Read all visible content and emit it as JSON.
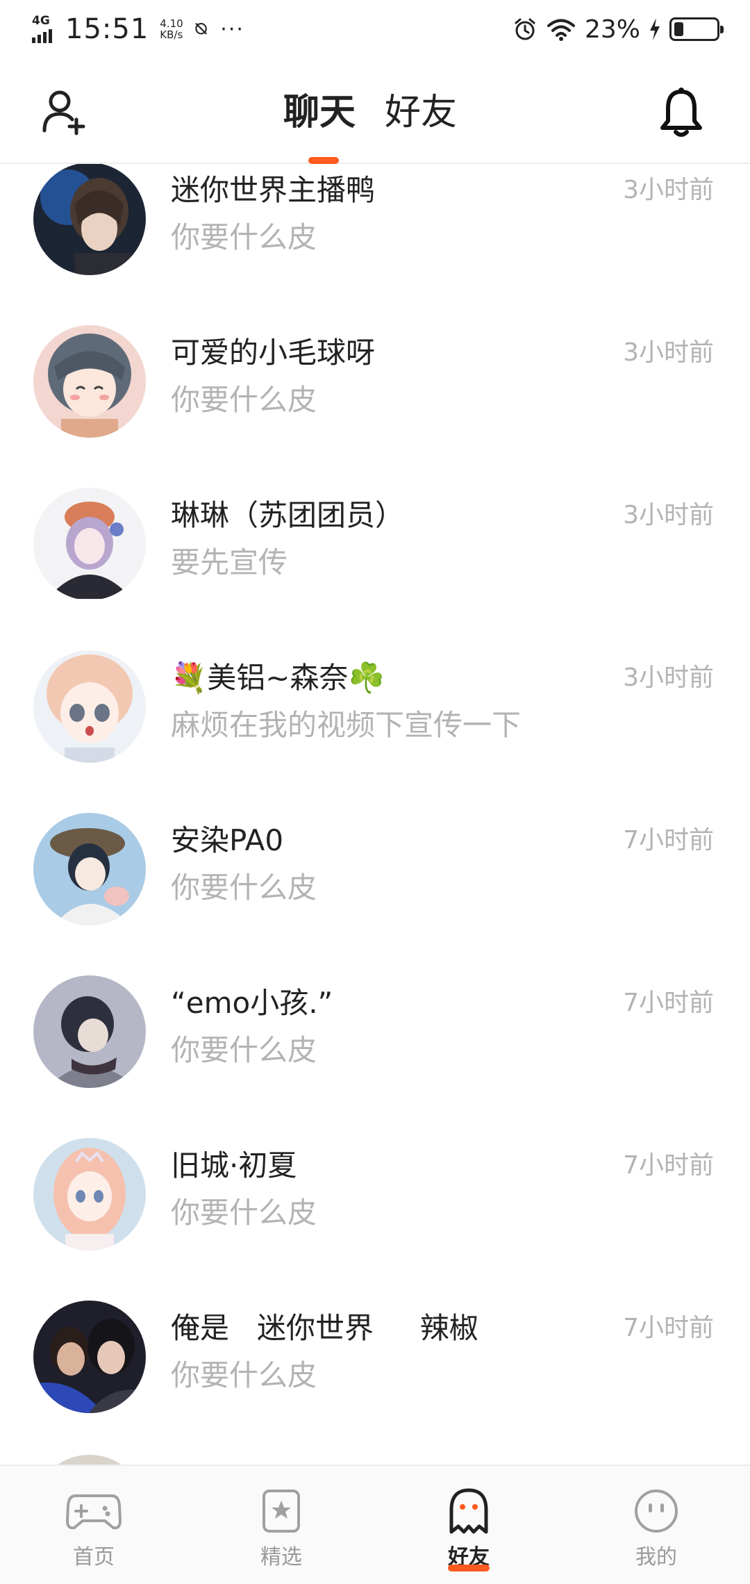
{
  "status_bar": {
    "network": "4G",
    "time": "15:51",
    "speed_value": "4.10",
    "speed_unit": "KB/s",
    "more": "···",
    "battery_pct": "23%",
    "battery_level": 0.23
  },
  "header": {
    "tabs": [
      {
        "label": "聊天",
        "active": true
      },
      {
        "label": "好友",
        "active": false
      }
    ],
    "left_icon": "add-friend-icon",
    "right_icon": "bell-icon"
  },
  "chats": [
    {
      "name": "迷你世界主播鸭",
      "message": "你要什么皮",
      "time": "3小时前"
    },
    {
      "name": "可爱的小毛球呀",
      "message": "你要什么皮",
      "time": "3小时前"
    },
    {
      "name": "琳琳（苏团团员）",
      "message": "要先宣传",
      "time": "3小时前"
    },
    {
      "name": "美铝~森奈",
      "name_prefix_emoji": "💐",
      "name_suffix_emoji": "☘️",
      "message": "麻烦在我的视频下宣传一下",
      "time": "3小时前"
    },
    {
      "name": "安染PA0",
      "message": "你要什么皮",
      "time": "7小时前"
    },
    {
      "name": "“emo小孩.”",
      "message": "你要什么皮",
      "time": "7小时前"
    },
    {
      "name": "旧城·初夏",
      "message": "你要什么皮",
      "time": "7小时前"
    },
    {
      "name": "俺是   迷你世界     辣椒",
      "message": "你要什么皮",
      "time": "7小时前"
    }
  ],
  "colors": {
    "accent": "#ff5a1f",
    "text_primary": "#222222",
    "text_secondary": "#b3b3b3"
  },
  "bottom_nav": [
    {
      "label": "首页",
      "icon": "gamepad-icon",
      "active": false
    },
    {
      "label": "精选",
      "icon": "star-bookmark-icon",
      "active": false
    },
    {
      "label": "好友",
      "icon": "ghost-icon",
      "active": true
    },
    {
      "label": "我的",
      "icon": "smiley-face-icon",
      "active": false
    }
  ]
}
